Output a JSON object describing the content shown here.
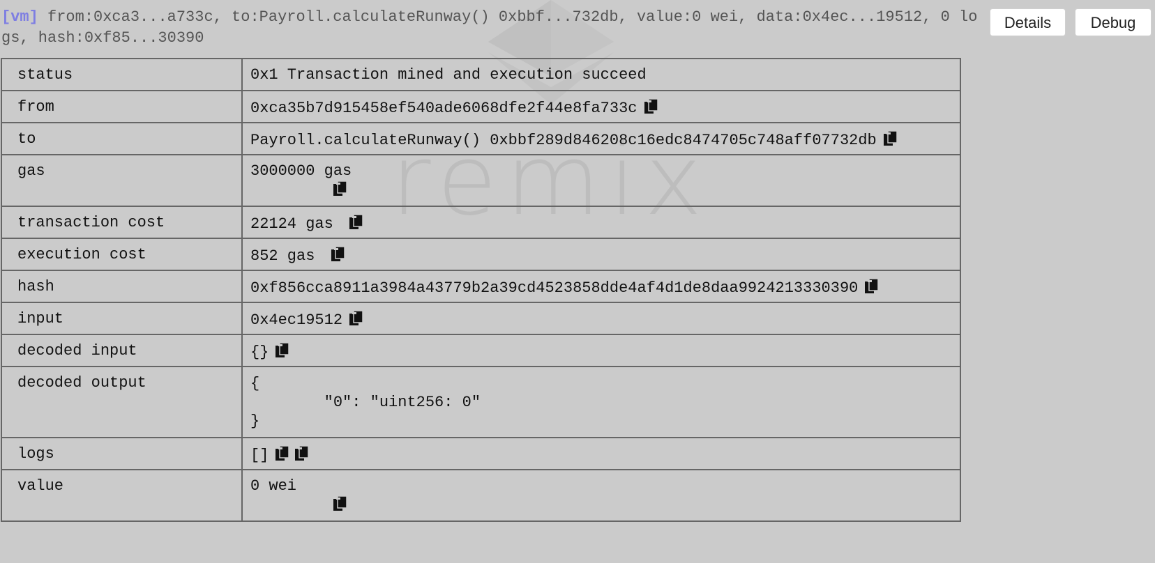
{
  "watermark": {
    "text": "remix"
  },
  "summary": {
    "tag": "[vm]",
    "text": " from:0xca3...a733c, to:Payroll.calculateRunway() 0xbbf...732db, value:0 wei, data:0x4ec...19512, 0 logs, hash:0xf85...30390"
  },
  "buttons": {
    "details": "Details",
    "debug": "Debug"
  },
  "rows": {
    "status": {
      "key": "status",
      "value": "0x1 Transaction mined and execution succeed"
    },
    "from": {
      "key": "from",
      "value": "0xca35b7d915458ef540ade6068dfe2f44e8fa733c"
    },
    "to": {
      "key": "to",
      "value": "Payroll.calculateRunway() 0xbbf289d846208c16edc8474705c748aff07732db"
    },
    "gas": {
      "key": "gas",
      "value": "3000000 gas"
    },
    "transaction_cost": {
      "key": "transaction cost",
      "value": "22124 gas"
    },
    "execution_cost": {
      "key": "execution cost",
      "value": "852 gas"
    },
    "hash": {
      "key": "hash",
      "value": "0xf856cca8911a3984a43779b2a39cd4523858dde4af4d1de8daa9924213330390"
    },
    "input": {
      "key": "input",
      "value": "0x4ec19512"
    },
    "decoded_input": {
      "key": "decoded input",
      "value": "{}"
    },
    "decoded_output": {
      "key": "decoded output",
      "value": "{\n\t\"0\": \"uint256: 0\"\n}"
    },
    "logs": {
      "key": "logs",
      "value": "[]"
    },
    "value": {
      "key": "value",
      "value": "0 wei"
    }
  },
  "icons": {
    "copy": "copy-icon",
    "logo": "ethereum-logo-icon"
  }
}
